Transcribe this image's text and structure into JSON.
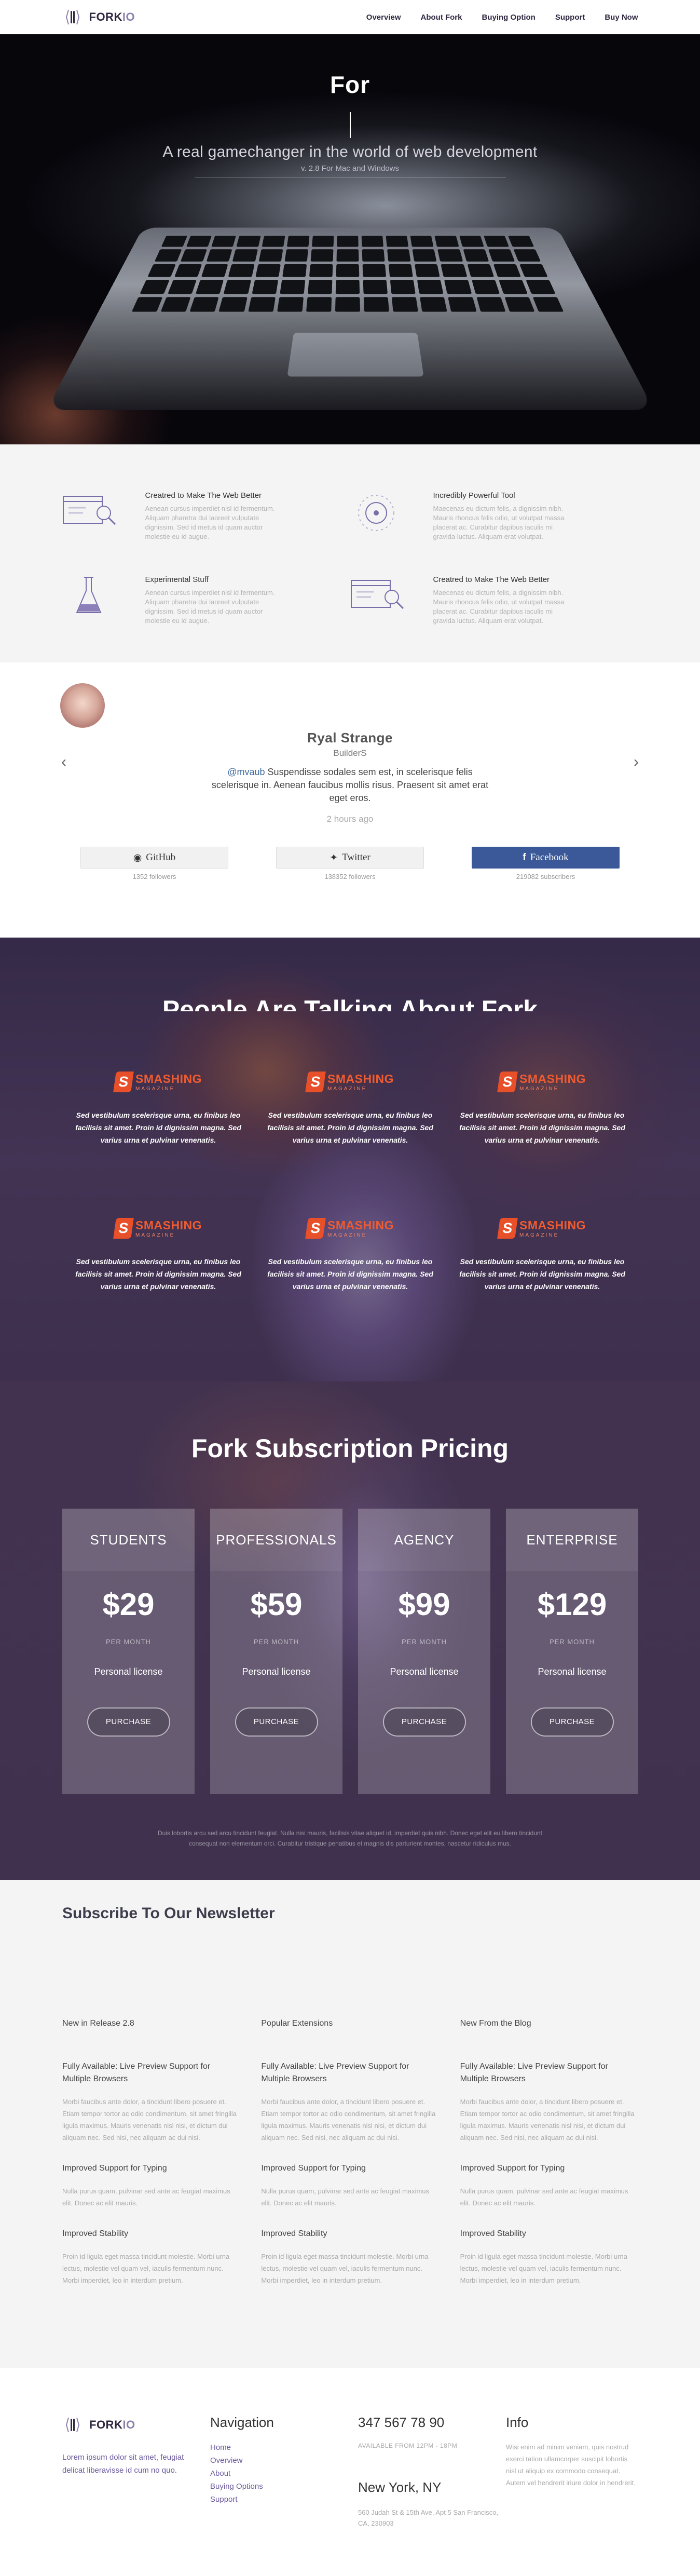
{
  "header": {
    "logo_text": "FORK",
    "logo_suffix": "IO",
    "nav": [
      "Overview",
      "About Fork",
      "Buying Option",
      "Support",
      "Buy Now"
    ]
  },
  "hero": {
    "title": "For",
    "subtitle": "A real gamechanger in the world of web development",
    "version": "v. 2.8 For Mac and Windows"
  },
  "features": [
    {
      "icon": "browser-search-icon",
      "title": "Creatred to Make The Web Better",
      "text": "Aenean cursus imperdiet nisl id fermentum. Aliquam pharetra dui laoreet vulputate dignissim. Sed id metus id quam auctor molestie eu id augue."
    },
    {
      "icon": "disc-icon",
      "title": "Incredibly Powerful Tool",
      "text": "Maecenas eu dictum felis, a dignissim nibh. Mauris rhoncus felis odio, ut volutpat massa placerat ac. Curabitur dapibus iaculis mi gravida luctus. Aliquam erat volutpat."
    },
    {
      "icon": "flask-icon",
      "title": "Experimental Stuff",
      "text": "Aenean cursus imperdiet nisl id fermentum. Aliquam pharetra dui laoreet vulputate dignissim. Sed id metus id quam auctor molestie eu id augue."
    },
    {
      "icon": "browser-search-icon",
      "title": "Creatred to Make The Web Better",
      "text": "Maecenas eu dictum felis, a dignissim nibh. Mauris rhoncus felis odio, ut volutpat massa placerat ac. Curabitur dapibus iaculis mi gravida luctus. Aliquam erat volutpat."
    }
  ],
  "testimonial": {
    "name": "Ryal Strange",
    "role": "BuilderS",
    "handle": "@mvaub",
    "quote": " Suspendisse sodales sem est, in scelerisque felis scelerisque in. Aenean faucibus mollis risus. Praesent sit amet erat eget eros.",
    "time": "2 hours ago",
    "prev": "‹",
    "next": "›"
  },
  "socials": [
    {
      "label": "GitHub",
      "icon": "github-icon",
      "count": "1352 followers"
    },
    {
      "label": "Twitter",
      "icon": "twitter-icon",
      "count": "138352 followers"
    },
    {
      "label": "Facebook",
      "icon": "facebook-icon",
      "count": "219082 subscribers"
    }
  ],
  "talking": {
    "title": "People Are Talking About Fork",
    "brand": "SMASHING",
    "brand_sub": "MAGAZINE",
    "quote": "Sed vestibulum scelerisque urna, eu finibus leo facilisis sit amet. Proin id dignissim magna. Sed varius urna et pulvinar venenatis."
  },
  "pricing": {
    "title": "Fork Subscription Pricing",
    "plans": [
      {
        "name": "STUDENTS",
        "price": "$29",
        "per": "PER MONTH",
        "license": "Personal license",
        "cta": "PURCHASE"
      },
      {
        "name": "PROFESSIONALS",
        "price": "$59",
        "per": "PER MONTH",
        "license": "Personal license",
        "cta": "PURCHASE"
      },
      {
        "name": "AGENCY",
        "price": "$99",
        "per": "PER MONTH",
        "license": "Personal license",
        "cta": "PURCHASE"
      },
      {
        "name": "ENTERPRISE",
        "price": "$129",
        "per": "PER MONTH",
        "license": "Personal license",
        "cta": "PURCHASE"
      }
    ],
    "fine_1": "Duis lobortis arcu sed arcu tincidunt feugiat. Nulla nisi mauris, facilisis vitae aliquet id, imperdiet quis nibh. Donec eget elit eu libero tincidunt",
    "fine_2": "consequat non elementum orci. Curabitur tristique penatibus et magnis dis parturient montes, nascetur ridiculus mus."
  },
  "newsletter": {
    "title": "Subscribe To Our Newsletter",
    "columns": [
      {
        "head": "New in Release 2.8",
        "items": [
          {
            "title": "Fully Available: Live Preview Support for Multiple Browsers",
            "text": "Morbi faucibus ante dolor, a tincidunt libero posuere et. Etiam tempor tortor ac odio condimentum, sit amet fringilla ligula maximus. Mauris venenatis nisl nisi, et dictum dui aliquam nec. Sed nisi, nec aliquam ac dui nisi."
          },
          {
            "title": "Improved Support for Typing",
            "text": "Nulla purus quam, pulvinar sed ante ac feugiat maximus elit. Donec ac elit mauris."
          },
          {
            "title": "Improved Stability",
            "text": "Proin id ligula eget massa tincidunt molestie. Morbi urna lectus, molestie vel quam vel, iaculis fermentum nunc. Morbi imperdiet, leo in interdum pretium."
          }
        ]
      },
      {
        "head": "Popular Extensions",
        "items": [
          {
            "title": "Fully Available: Live Preview Support for Multiple Browsers",
            "text": "Morbi faucibus ante dolor, a tincidunt libero posuere et. Etiam tempor tortor ac odio condimentum, sit amet fringilla ligula maximus. Mauris venenatis nisl nisi, et dictum dui aliquam nec. Sed nisi, nec aliquam ac dui nisi."
          },
          {
            "title": "Improved Support for Typing",
            "text": "Nulla purus quam, pulvinar sed ante ac feugiat maximus elit. Donec ac elit mauris."
          },
          {
            "title": "Improved Stability",
            "text": "Proin id ligula eget massa tincidunt molestie. Morbi urna lectus, molestie vel quam vel, iaculis fermentum nunc. Morbi imperdiet, leo in interdum pretium."
          }
        ]
      },
      {
        "head": "New From the Blog",
        "items": [
          {
            "title": "Fully Available: Live Preview Support for Multiple Browsers",
            "text": "Morbi faucibus ante dolor, a tincidunt libero posuere et. Etiam tempor tortor ac odio condimentum, sit amet fringilla ligula maximus. Mauris venenatis nisl nisi, et dictum dui aliquam nec. Sed nisi, nec aliquam ac dui nisi."
          },
          {
            "title": "Improved Support for Typing",
            "text": "Nulla purus quam, pulvinar sed ante ac feugiat maximus elit. Donec ac elit mauris."
          },
          {
            "title": "Improved Stability",
            "text": "Proin id ligula eget massa tincidunt molestie. Morbi urna lectus, molestie vel quam vel, iaculis fermentum nunc. Morbi imperdiet, leo in interdum pretium."
          }
        ]
      }
    ]
  },
  "footer": {
    "desc": "Lorem ipsum dolor sit amet, feugiat delicat liberavisse id cum no quo.",
    "nav_title": "Navigation",
    "nav": [
      "Home",
      "Overview",
      "About",
      "Buying Options",
      "Support"
    ],
    "phone": "347 567 78 90",
    "availability": "AVAILABLE FROM 12PM - 18PM",
    "city": "New York, NY",
    "address": "560 Judah St & 15th Ave, Apt 5 San Francisco, CA, 230903",
    "info_title": "Info",
    "info": "Wisi enim ad minim veniam, quis nostrud exerci tation ullamcorper suscipit lobortis nisl ut aliquip ex commodo consequat. Autem vel hendrerit iriure dolor in hendrerit."
  }
}
